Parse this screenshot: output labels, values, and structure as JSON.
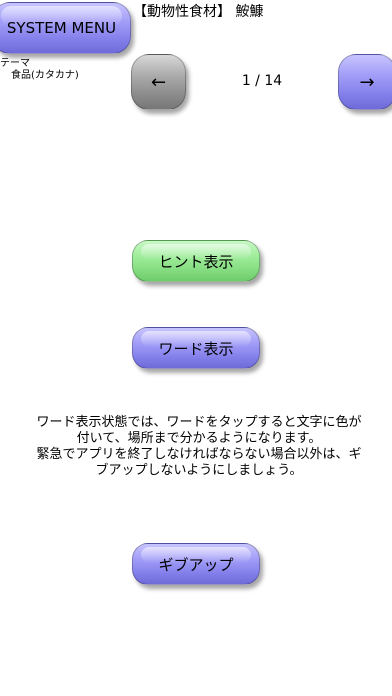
{
  "header": {
    "system_menu_label": "SYSTEM MENU",
    "title": "【動物性食材】 鮟鱇"
  },
  "theme": {
    "label": "テーマ",
    "value": "食品(カタカナ)"
  },
  "pager": {
    "prev_label": "←",
    "next_label": "→",
    "counter": "1 / 14"
  },
  "actions": {
    "hint_label": "ヒント表示",
    "word_label": "ワード表示",
    "giveup_label": "ギブアップ"
  },
  "description": "ワード表示状態では、ワードをタップすると文字に色が付いて、場所まで分かるようになります。\n緊急でアプリを終了しなければならない場合以外は、ギブアップしないようにしましょう。",
  "colors": {
    "blue_button": "#8682ec",
    "green_button": "#86de82",
    "gray_button": "#a9a9a9"
  }
}
